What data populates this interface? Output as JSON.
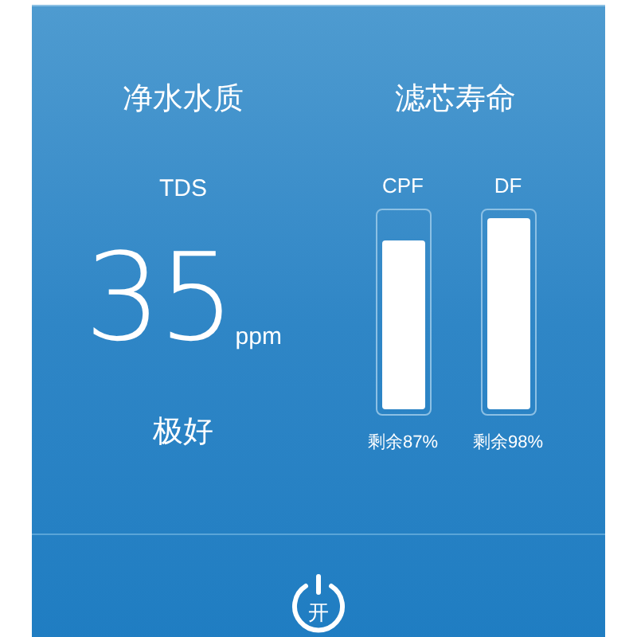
{
  "water_quality": {
    "title": "净水水质",
    "metric": "TDS",
    "value": "35",
    "unit": "ppm",
    "rating": "极好"
  },
  "filter_life": {
    "title": "滤芯寿命",
    "filters": [
      {
        "name": "CPF",
        "level": 0.87,
        "remaining": "剩余87%"
      },
      {
        "name": "DF",
        "level": 0.98,
        "remaining": "剩余98%"
      }
    ]
  },
  "power": {
    "label": "开"
  }
}
